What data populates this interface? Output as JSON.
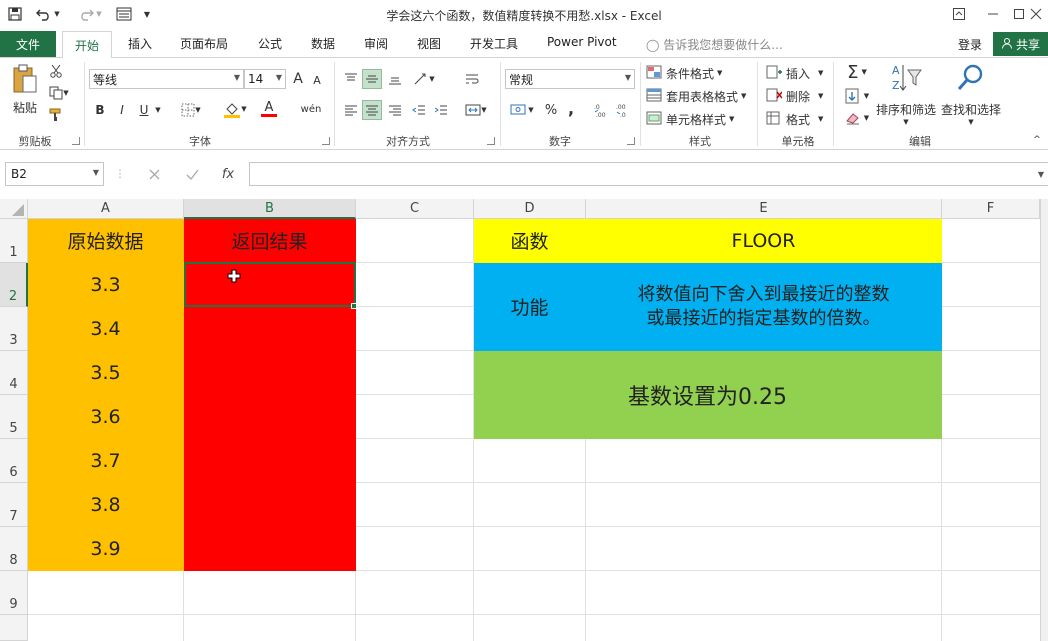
{
  "window": {
    "title": "学会这六个函数，数值精度转换不用愁.xlsx - Excel"
  },
  "tabs": {
    "file": "文件",
    "home": "开始",
    "items": [
      "插入",
      "页面布局",
      "公式",
      "数据",
      "审阅",
      "视图",
      "开发工具",
      "Power Pivot"
    ],
    "tell_me_placeholder": "告诉我您想要做什么...",
    "login": "登录",
    "share": "共享"
  },
  "ribbon": {
    "clipboard": {
      "paste": "粘贴",
      "label": "剪贴板"
    },
    "font": {
      "name": "等线",
      "size": "14",
      "label": "字体",
      "bold": "B",
      "italic": "I",
      "underline": "U",
      "grow": "A",
      "shrink": "A",
      "font_color": "A",
      "phonetic": "wén"
    },
    "alignment": {
      "label": "对齐方式"
    },
    "number": {
      "format": "常规",
      "label": "数字",
      "percent": "%",
      "comma": ","
    },
    "styles": {
      "conditional": "条件格式",
      "table": "套用表格格式",
      "cell": "单元格样式",
      "label": "样式"
    },
    "cells": {
      "insert": "插入",
      "delete": "删除",
      "format": "格式",
      "label": "单元格"
    },
    "editing": {
      "sort_filter": "排序和筛选",
      "find_select": "查找和选择",
      "label": "编辑"
    }
  },
  "formula_bar": {
    "name_box": "B2",
    "fx": "fx",
    "value": ""
  },
  "grid": {
    "columns": [
      "A",
      "B",
      "C",
      "D",
      "E",
      "F"
    ],
    "rows": [
      "1",
      "2",
      "3",
      "4",
      "5",
      "6",
      "7",
      "8",
      "9"
    ],
    "selected_cell": "B2",
    "col_a_header": "原始数据",
    "col_b_header": "返回结果",
    "col_a_values": [
      "3.3",
      "3.4",
      "3.5",
      "3.6",
      "3.7",
      "3.8",
      "3.9"
    ],
    "info": {
      "func_label": "函数",
      "func_name": "FLOOR",
      "purpose_label": "功能",
      "purpose_line1": "将数值向下舍入到最接近的整数",
      "purpose_line2": "或最接近的指定基数的倍数。",
      "note": "基数设置为0.25"
    },
    "colors": {
      "orange": "#ffc000",
      "red": "#ff0000",
      "yellow": "#ffff00",
      "blue": "#00b0f0",
      "green": "#92d050",
      "excel_green": "#217346"
    }
  }
}
